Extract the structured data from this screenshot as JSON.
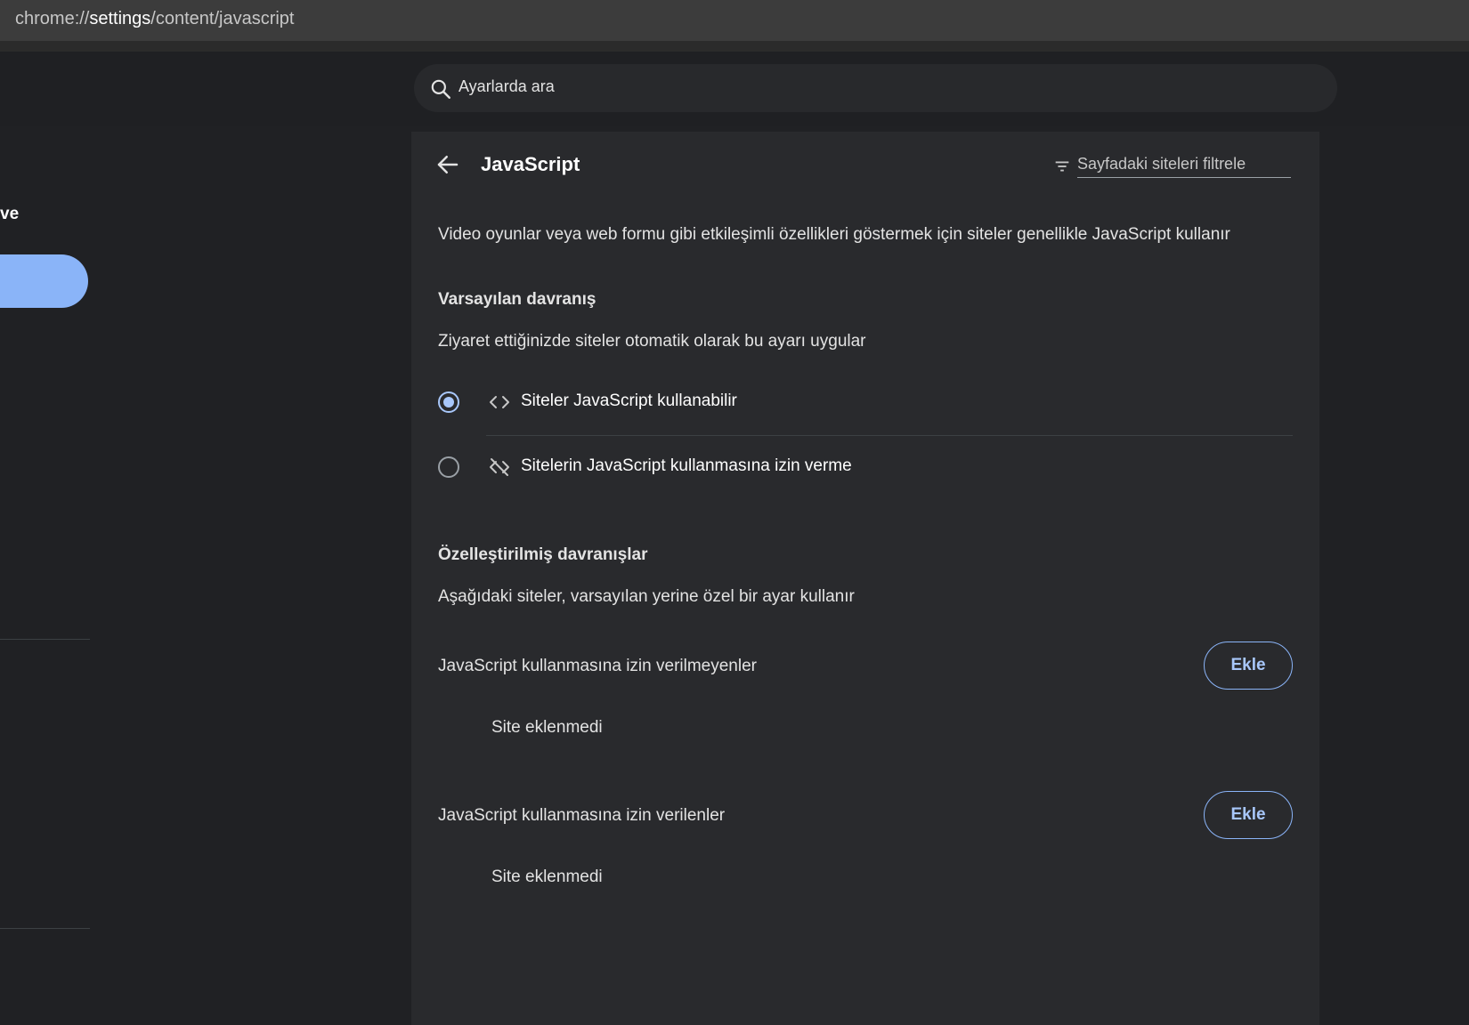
{
  "browser": {
    "url_scheme": "chrome://",
    "url_host": "settings",
    "url_path": "/content/javascript"
  },
  "header": {
    "search_placeholder": "Ayarlarda ara"
  },
  "sidebar": {
    "partial_label": "ve"
  },
  "page": {
    "title": "JavaScript",
    "filter_placeholder": "Sayfadaki siteleri filtrele",
    "description": "Video oyunlar veya web formu gibi etkileşimli özellikleri göstermek için siteler genellikle JavaScript kullanır"
  },
  "default_behavior": {
    "title": "Varsayılan davranış",
    "subtitle": "Ziyaret ettiğinizde siteler otomatik olarak bu ayarı uygular",
    "options": [
      {
        "label": "Siteler JavaScript kullanabilir",
        "icon": "code-icon",
        "selected": true
      },
      {
        "label": "Sitelerin JavaScript kullanmasına izin verme",
        "icon": "code-off-icon",
        "selected": false
      }
    ]
  },
  "custom_behavior": {
    "title": "Özelleştirilmiş davranışlar",
    "subtitle": "Aşağıdaki siteler, varsayılan yerine özel bir ayar kullanır",
    "lists": [
      {
        "header": "JavaScript kullanmasına izin verilmeyenler",
        "add_label": "Ekle",
        "empty_text": "Site eklenmedi"
      },
      {
        "header": "JavaScript kullanmasına izin verilenler",
        "add_label": "Ekle",
        "empty_text": "Site eklenmedi"
      }
    ]
  },
  "colors": {
    "accent": "#8ab4f8",
    "background": "#202124",
    "card": "#292a2d"
  }
}
